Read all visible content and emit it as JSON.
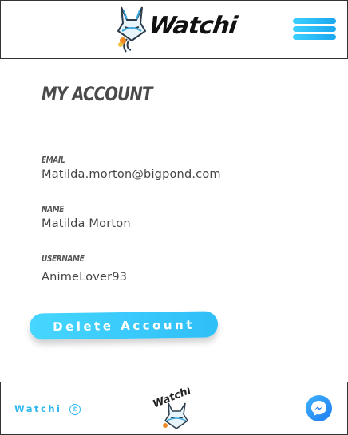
{
  "header": {
    "brand": "Watchi",
    "logo_icon": "fox-mask-logo-icon",
    "menu_icon": "hamburger-menu-icon"
  },
  "page": {
    "title": "My Account"
  },
  "account": {
    "email_label": "Email",
    "email_value": "Matilda.morton@bigpond.com",
    "name_label": "Name",
    "name_value": "Matilda Morton",
    "username_label": "Username",
    "username_value": "AnimeLover93"
  },
  "actions": {
    "delete_label": "Delete Account"
  },
  "footer": {
    "brand": "Watchi",
    "copyright_symbol": "©",
    "logo_icon": "watchi-mask-logo-icon",
    "messenger_icon": "messenger-icon"
  },
  "colors": {
    "accent": "#2fbff8",
    "text": "#444444"
  }
}
